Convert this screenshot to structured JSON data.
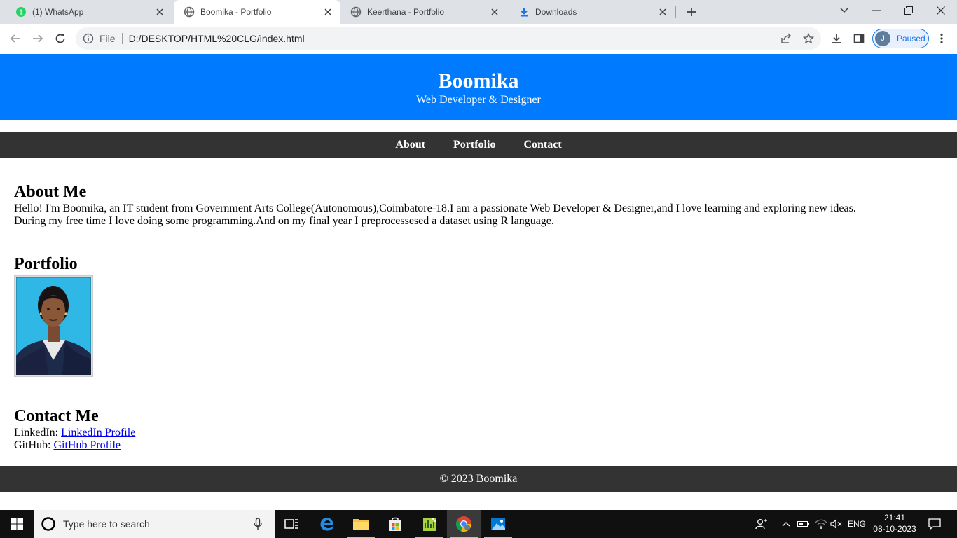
{
  "browser": {
    "tabs": [
      {
        "title": "(1) WhatsApp",
        "favicon": "whatsapp-icon",
        "badge": "1"
      },
      {
        "title": "Boomika - Portfolio",
        "favicon": "globe-icon"
      },
      {
        "title": "Keerthana - Portfolio",
        "favicon": "globe-icon"
      },
      {
        "title": "Downloads",
        "favicon": "download-icon"
      }
    ],
    "active_tab": 1,
    "address": {
      "scheme": "File",
      "url": "D:/DESKTOP/HTML%20CLG/index.html"
    },
    "profile": {
      "initial": "J",
      "label": "Paused"
    },
    "accent_color": "#1a73e8"
  },
  "site": {
    "header": {
      "title": "Boomika",
      "subtitle": "Web Developer & Designer",
      "bg_color": "#007bff"
    },
    "nav": [
      "About",
      "Portfolio",
      "Contact"
    ],
    "about": {
      "heading": "About Me",
      "line1": "Hello! I'm Boomika, an IT student from Government Arts College(Autonomous),Coimbatore-18.I am a passionate Web Developer & Designer,and I love learning and exploring new ideas.",
      "line2": "During my free time I love doing some programming.And on my final year I preprocessesed a dataset using R language."
    },
    "portfolio": {
      "heading": "Portfolio"
    },
    "contact": {
      "heading": "Contact Me",
      "linkedin_label": "LinkedIn:",
      "linkedin_link": "LinkedIn Profile",
      "github_label": "GitHub:",
      "github_link": "GitHub Profile"
    },
    "footer": "© 2023 Boomika"
  },
  "taskbar": {
    "search_placeholder": "Type here to search",
    "language": "ENG",
    "time": "21:41",
    "date": "08-10-2023"
  }
}
